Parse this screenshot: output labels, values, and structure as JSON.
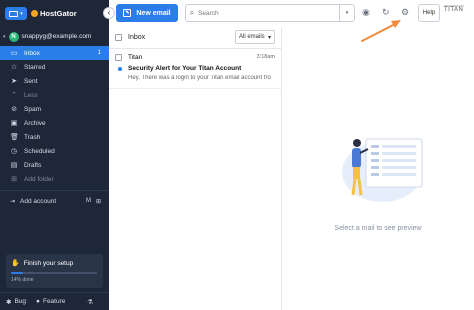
{
  "brand": {
    "name": "HostGator"
  },
  "account": {
    "avatar_letter": "N",
    "email": "snappyg@example.com"
  },
  "nav": [
    {
      "label": "Inbox",
      "icon": "inbox-icon",
      "glyph": "▭",
      "count": "1",
      "active": true
    },
    {
      "label": "Starred",
      "icon": "star-icon",
      "glyph": "☆"
    },
    {
      "label": "Sent",
      "icon": "send-icon",
      "glyph": "➤"
    },
    {
      "label": "Less",
      "icon": "chevron-up-icon",
      "glyph": "⌃",
      "muted": true
    },
    {
      "label": "Spam",
      "icon": "spam-icon",
      "glyph": "⊘"
    },
    {
      "label": "Archive",
      "icon": "archive-icon",
      "glyph": "▣"
    },
    {
      "label": "Trash",
      "icon": "trash-icon",
      "glyph": "🗑"
    },
    {
      "label": "Scheduled",
      "icon": "clock-icon",
      "glyph": "◷"
    },
    {
      "label": "Drafts",
      "icon": "draft-icon",
      "glyph": "▤"
    },
    {
      "label": "Add folder",
      "icon": "add-folder-icon",
      "glyph": "⊞",
      "muted": true
    }
  ],
  "add_account": {
    "label": "Add account"
  },
  "setup": {
    "title": "Finish your setup",
    "progress_label": "14% done",
    "progress": 0.14
  },
  "bottom": {
    "bug": "Bug",
    "feature": "Feature"
  },
  "toolbar": {
    "new_email": "New email",
    "search_placeholder": "Search",
    "help": "Help",
    "powered_by": "POWERED BY",
    "titan": "TITAN"
  },
  "list": {
    "folder": "Inbox",
    "filter": "All emails",
    "messages": [
      {
        "sender": "Titan",
        "time": "3:18am",
        "subject": "Security Alert for Your Titan Account",
        "preview": "Hey, There was a login to your Titan email account fro",
        "unread": true
      }
    ]
  },
  "preview": {
    "empty_text": "Select a mail to see preview"
  },
  "colors": {
    "accent": "#2b7de9",
    "sidebar": "#1e2738",
    "arrow": "#f08a3c"
  }
}
